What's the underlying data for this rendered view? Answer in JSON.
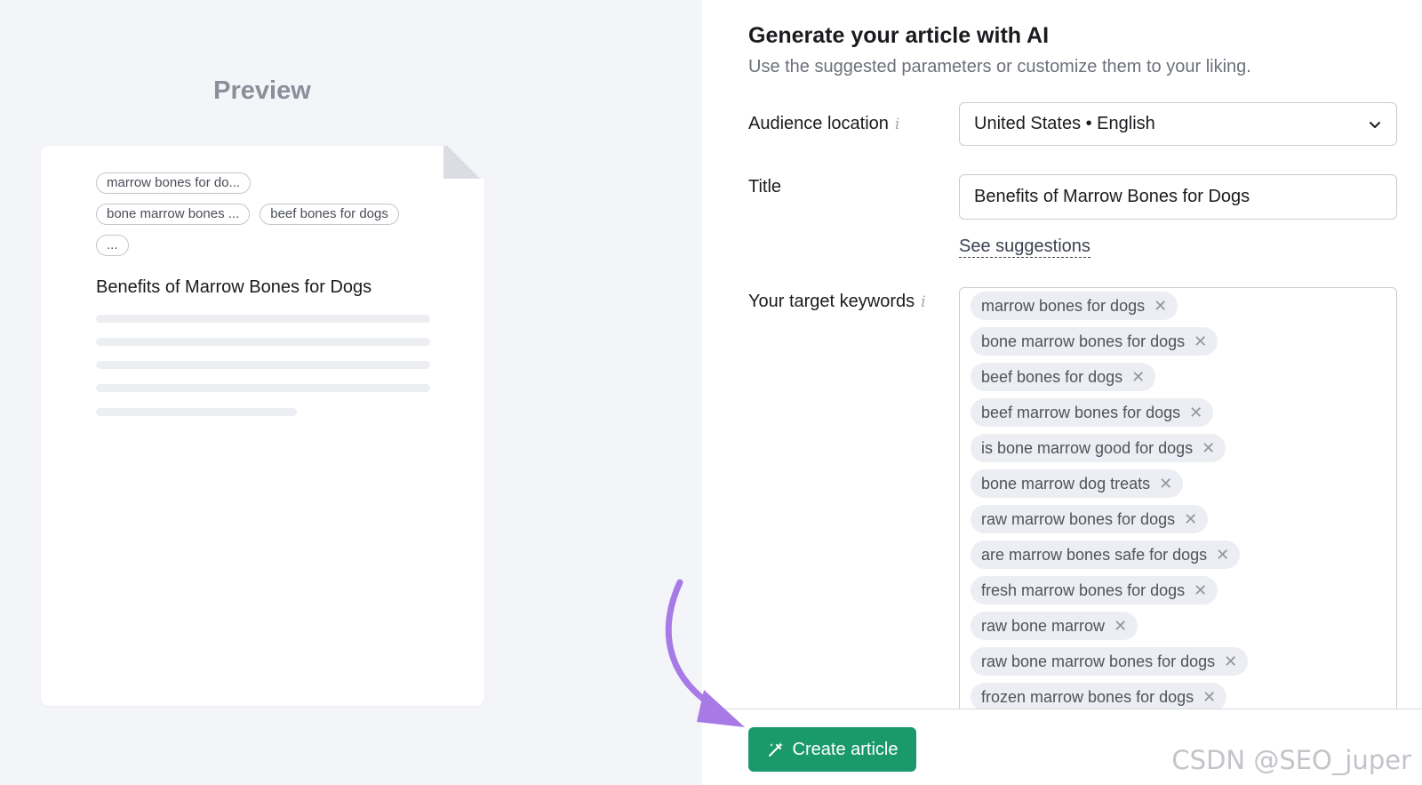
{
  "preview": {
    "title": "Preview",
    "chips_row1": [
      "marrow bones for do..."
    ],
    "chips_row2": [
      "bone marrow bones ...",
      "beef bones for dogs"
    ],
    "chips_row3": [
      "..."
    ],
    "heading": "Benefits of Marrow Bones for Dogs"
  },
  "form": {
    "title": "Generate your article with AI",
    "subtitle": "Use the suggested parameters or customize them to your liking.",
    "audience_label": "Audience location",
    "audience_value": "United States • English",
    "title_label": "Title",
    "title_value": "Benefits of Marrow Bones for Dogs",
    "suggestions_link": "See suggestions",
    "keywords_label": "Your target keywords",
    "keywords": [
      "marrow bones for dogs",
      "bone marrow bones for dogs",
      "beef bones for dogs",
      "beef marrow bones for dogs",
      "is bone marrow good for dogs",
      "bone marrow dog treats",
      "raw marrow bones for dogs",
      "are marrow bones safe for dogs",
      "fresh marrow bones for dogs",
      "raw bone marrow",
      "raw bone marrow bones for dogs",
      "frozen marrow bones for dogs"
    ],
    "remove_glyph": "✕",
    "info_glyph": "i"
  },
  "actions": {
    "create_label": "Create article"
  },
  "watermark": "CSDN @SEO_juper",
  "colors": {
    "accent": "#1a9a6c",
    "annotation_arrow": "#a77ae6",
    "preview_bg": "#f4f5f9"
  }
}
